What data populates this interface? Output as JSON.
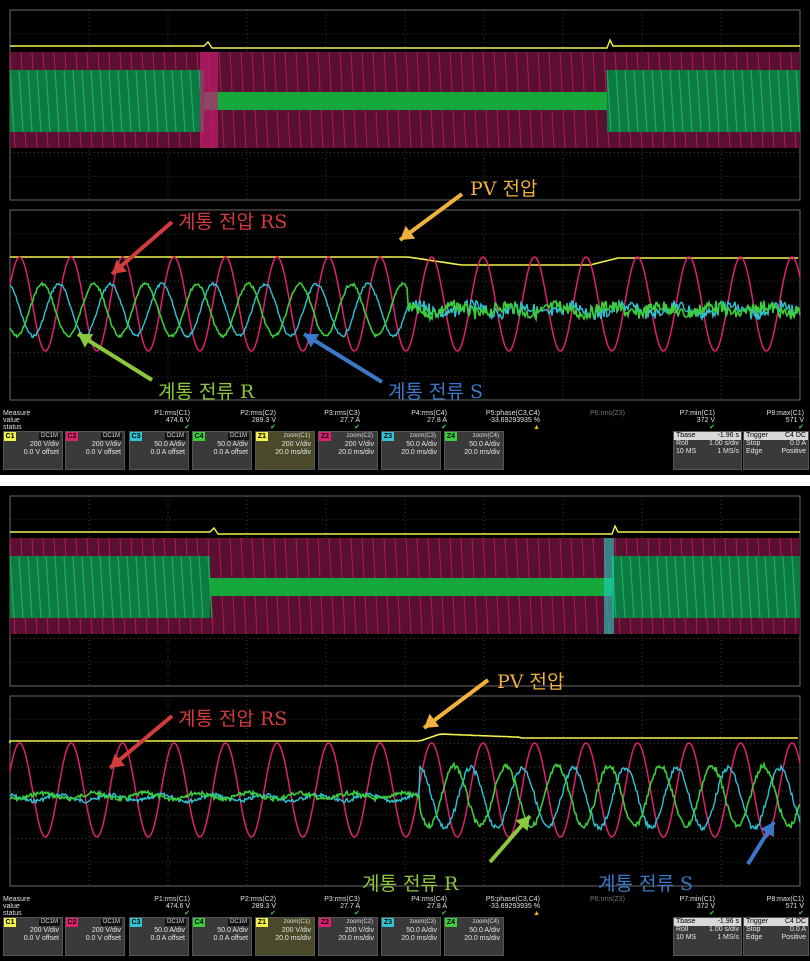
{
  "annotations": {
    "top": {
      "pv_voltage": "PV 전압",
      "grid_voltage_rs": "계통 전압 RS",
      "grid_current_r": "계통 전류 R",
      "grid_current_s": "계통 전류 S"
    },
    "bottom": {
      "pv_voltage": "PV 전압",
      "grid_voltage_rs": "계통 전압 RS",
      "grid_current_r": "계통 전류 R",
      "grid_current_s": "계통 전류 S"
    }
  },
  "colors": {
    "c1_yellow": "#f2f24a",
    "c2_magenta": "#e0206e",
    "c3_cyan": "#2ec4d4",
    "c4_green": "#3ccc3c",
    "ann_red": "#d23c3c",
    "ann_orange": "#f0b23c",
    "ann_green": "#8cc83c",
    "ann_blue": "#3c78c8"
  },
  "measure": {
    "header": "Measure",
    "value_label": "value",
    "status_label": "status",
    "params": [
      {
        "name": "P1:rms(C1)",
        "value": "474.6 V",
        "status": "✔"
      },
      {
        "name": "P2:rms(C2)",
        "value": "289.3 V",
        "status": "✔"
      },
      {
        "name": "P3:rms(C3)",
        "value": "27.7 A",
        "status": "✔"
      },
      {
        "name": "P4:rms(C4)",
        "value": "27.8 A",
        "status": "✔"
      },
      {
        "name": "P5:phase(C3,C4)",
        "value": "-33.69293935 %",
        "status": "▲"
      },
      {
        "name": "P6:rms(Z3)",
        "value": "",
        "status": ""
      },
      {
        "name": "P7:min(C1)",
        "value": "372 V",
        "status": "✔"
      },
      {
        "name": "P8:max(C1)",
        "value": "571 V",
        "status": "✔"
      }
    ]
  },
  "channels": [
    {
      "tag": "C1",
      "coupling": "DC1M",
      "scale": "200 V/div",
      "offset": "0.0 V offset",
      "color": "#f2f24a"
    },
    {
      "tag": "C2",
      "coupling": "DC1M",
      "scale": "200 V/div",
      "offset": "0.0 V offset",
      "color": "#e0206e"
    },
    {
      "tag": "C3",
      "coupling": "DC1M",
      "scale": "50.0 A/div",
      "offset": "0.0 A offset",
      "color": "#2ec4d4"
    },
    {
      "tag": "C4",
      "coupling": "DC1M",
      "scale": "50.0 A/div",
      "offset": "0.0 A offset",
      "color": "#3ccc3c"
    },
    {
      "tag": "Z1",
      "coupling": "zoom(C1)",
      "scale": "200 V/div",
      "offset": "20.0 ms/div",
      "color": "#f2f24a"
    },
    {
      "tag": "Z2",
      "coupling": "zoom(C2)",
      "scale": "200 V/div",
      "offset": "20.0 ms/div",
      "color": "#e0206e"
    },
    {
      "tag": "Z3",
      "coupling": "zoom(C3)",
      "scale": "50.0 A/div",
      "offset": "20.0 ms/div",
      "color": "#2ec4d4"
    },
    {
      "tag": "Z4",
      "coupling": "zoom(C4)",
      "scale": "50.0 A/div",
      "offset": "20.0 ms/div",
      "color": "#3ccc3c"
    }
  ],
  "timebase": {
    "label": "Tbase",
    "value": "-1.96 s",
    "mode": "Roll",
    "div": "1.00 s/div",
    "samples": "10 MS",
    "rate": "1 MS/s"
  },
  "trigger": {
    "label": "Trigger",
    "coupling": "C4 DC",
    "mode": "Stop",
    "level": "0.0 A",
    "type": "Edge",
    "slope": "Positive"
  }
}
